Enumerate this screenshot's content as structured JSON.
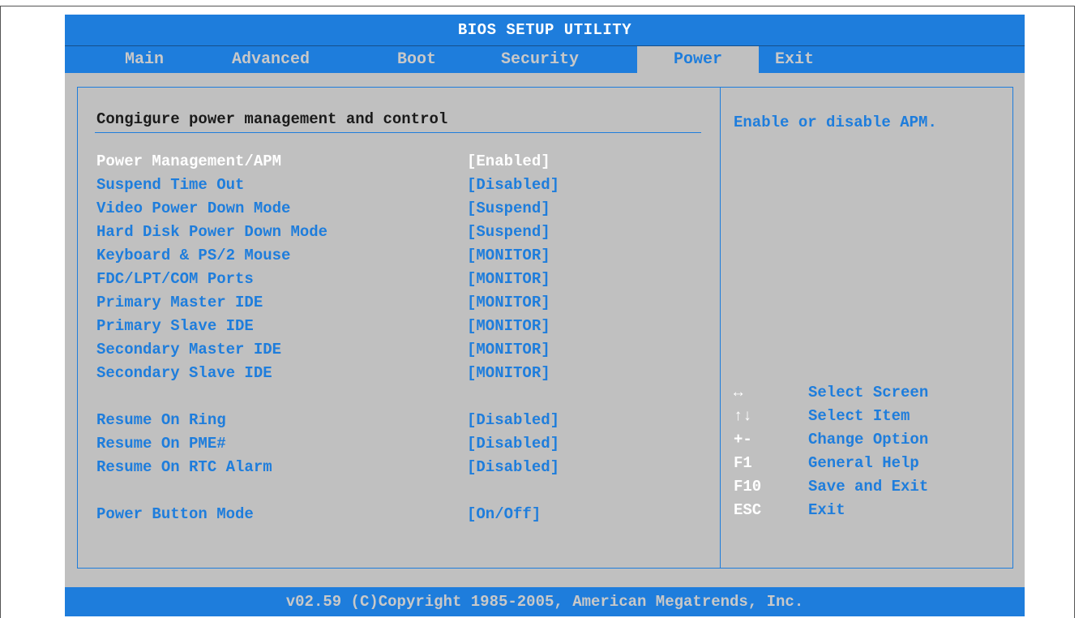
{
  "title": "BIOS SETUP UTILITY",
  "tabs": [
    {
      "label": "Main"
    },
    {
      "label": "Advanced"
    },
    {
      "label": "Boot"
    },
    {
      "label": "Security"
    },
    {
      "label": "Power",
      "active": true
    },
    {
      "label": "Exit"
    }
  ],
  "section_title": "Congigure power management and control",
  "settings": [
    {
      "label": "Power Management/APM",
      "value": "[Enabled]",
      "selected": true
    },
    {
      "label": "Suspend Time Out",
      "value": "[Disabled]"
    },
    {
      "label": "Video Power Down Mode",
      "value": "[Suspend]"
    },
    {
      "label": "Hard Disk Power Down Mode",
      "value": "[Suspend]"
    },
    {
      "label": "Keyboard & PS/2 Mouse",
      "value": "[MONITOR]"
    },
    {
      "label": "FDC/LPT/COM Ports",
      "value": "[MONITOR]"
    },
    {
      "label": "Primary Master IDE",
      "value": "[MONITOR]"
    },
    {
      "label": "Primary Slave IDE",
      "value": "[MONITOR]"
    },
    {
      "label": "Secondary Master IDE",
      "value": "[MONITOR]"
    },
    {
      "label": "Secondary Slave IDE",
      "value": "[MONITOR]"
    },
    {
      "label": "Resume On Ring",
      "value": "[Disabled]"
    },
    {
      "label": "Resume On PME#",
      "value": "[Disabled]"
    },
    {
      "label": "Resume On RTC Alarm",
      "value": "[Disabled]"
    },
    {
      "label": "Power Button Mode",
      "value": "[On/Off]"
    }
  ],
  "help_text": "Enable or disable APM.",
  "legend": [
    {
      "key": "↔",
      "desc": "Select Screen"
    },
    {
      "key": "↑↓",
      "desc": "Select Item"
    },
    {
      "key": "+-",
      "desc": "Change Option"
    },
    {
      "key": "F1",
      "desc": "General Help"
    },
    {
      "key": "F10",
      "desc": "Save and Exit"
    },
    {
      "key": "ESC",
      "desc": "Exit"
    }
  ],
  "footer": "v02.59 (C)Copyright 1985-2005, American Megatrends, Inc.",
  "colors": {
    "accent": "#1e7ddc",
    "panel_bg": "#c0c0c0",
    "highlight_text": "#ffffff",
    "inactive_tab_text": "#c8c8c8"
  }
}
